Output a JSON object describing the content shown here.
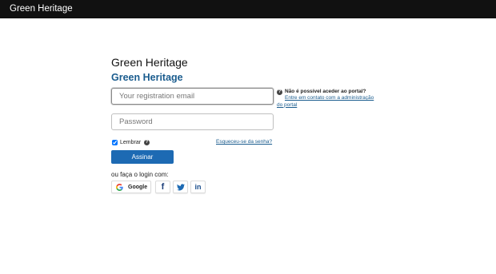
{
  "header": {
    "brand": "Green Heritage"
  },
  "login": {
    "page_title": "Green Heritage",
    "site_title": "Green Heritage",
    "email_placeholder": "Your registration email",
    "password_placeholder": "Password",
    "remember_label": "Lembrar",
    "remember_checked": true,
    "forgot_link": "Esqueceu-se da senha?",
    "submit_label": "Assinar",
    "social_label": "ou faça o login com:",
    "google_label": "Google"
  },
  "social_icons": [
    "google-icon",
    "facebook-icon",
    "twitter-icon",
    "linkedin-icon"
  ],
  "notice": {
    "title": "Não é possível aceder ao portal?",
    "link": "Entre em contato com a administração do portal"
  },
  "colors": {
    "topbar": "#111111",
    "accent": "#1d6ab3",
    "link": "#1a5c8e"
  }
}
